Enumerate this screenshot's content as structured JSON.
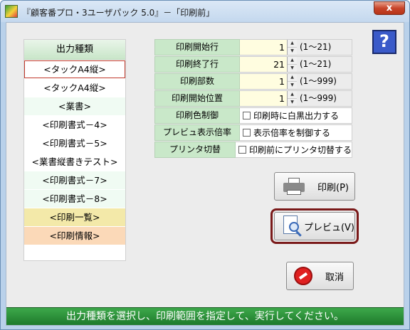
{
  "window": {
    "title": "『顧客番プロ・3ユーザパック 5.0』－「印刷前」",
    "close_label": "x"
  },
  "help": {
    "label": "?"
  },
  "output_types": {
    "header": "出力種類",
    "items": [
      {
        "label": "<タックA4縦>"
      },
      {
        "label": "<タックA4縦>"
      },
      {
        "label": "<業書>"
      },
      {
        "label": "<印刷書式－4>"
      },
      {
        "label": "<印刷書式－5>"
      },
      {
        "label": "<業書縦書きテスト>"
      },
      {
        "label": "<印刷書式－7>"
      },
      {
        "label": "<印刷書式－8>"
      },
      {
        "label": "<印刷一覧>"
      },
      {
        "label": "<印刷情報>"
      }
    ]
  },
  "settings": {
    "start_row": {
      "label": "印刷開始行",
      "value": "1",
      "range": "(1～21)"
    },
    "end_row": {
      "label": "印刷終了行",
      "value": "21",
      "range": "(1～21)"
    },
    "copies": {
      "label": "印刷部数",
      "value": "1",
      "range": "(1～999)"
    },
    "start_pos": {
      "label": "印刷開始位置",
      "value": "1",
      "range": "(1～999)"
    },
    "color": {
      "label": "印刷色制御",
      "check_label": "印刷時に白黒出力する",
      "checked": false
    },
    "zoom": {
      "label": "プレビュ表示倍率",
      "check_label": "表示倍率を制御する",
      "checked": false
    },
    "printer": {
      "label": "プリンタ切替",
      "check_label": "印刷前にプリンタ切替する",
      "checked": false
    }
  },
  "buttons": {
    "print": "印刷(P)",
    "preview": "プレビュ(V)",
    "cancel": "取消"
  },
  "status": "出力種類を選択し、印刷範囲を指定して、実行してください。"
}
